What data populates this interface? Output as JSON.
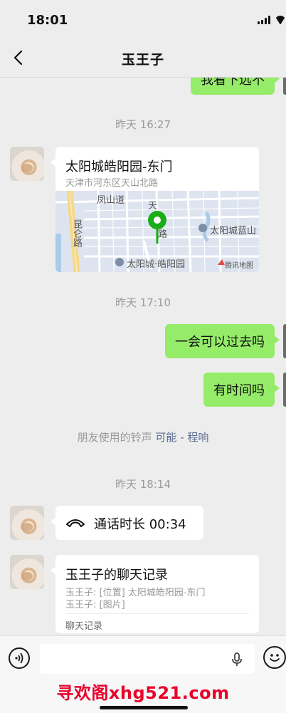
{
  "status": {
    "time": "18:01"
  },
  "nav": {
    "title": "玉王子"
  },
  "messages": {
    "top_partial": "我看下远不",
    "time1": "昨天 16:27",
    "location": {
      "title": "太阳城皓阳园-东门",
      "address": "天津市河东区天山北路",
      "map_labels": [
        "凤山道",
        "天",
        "路",
        "昆仑路",
        "太阳城蓝山",
        "太阳城·皓阳园",
        "腾讯地图"
      ]
    },
    "time2": "昨天 17:10",
    "out1": "一会可以过去吗",
    "out2": "有时间吗",
    "ringtone": {
      "prefix": "朋友使用的铃声",
      "link": "可能 - 程响"
    },
    "time3": "昨天 18:14",
    "call": "通话时长 00:34",
    "record": {
      "title": "玉王子的聊天记录",
      "line1": "玉王子: [位置] 太阳城皓阳园-东门",
      "line2": "玉王子: [图片]",
      "footer": "聊天记录"
    }
  },
  "input": {
    "placeholder": "",
    "watermark": "寻欢阁xhg521.com"
  },
  "colors": {
    "bubble_out": "#95ec69",
    "background": "#ededed",
    "link": "#576b95",
    "watermark": "#e8002a"
  }
}
